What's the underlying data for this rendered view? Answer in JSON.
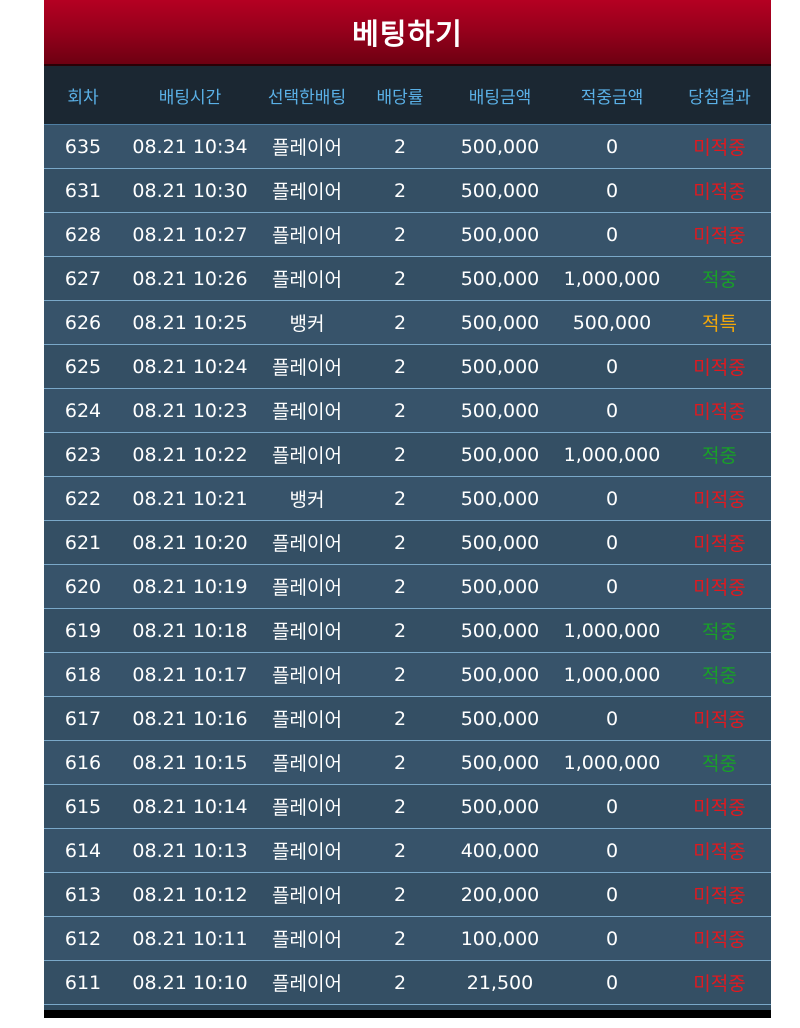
{
  "title": "베팅하기",
  "columns": {
    "round": "회차",
    "time": "배팅시간",
    "pick": "선택한배팅",
    "odds": "배당률",
    "bet": "배팅금액",
    "win": "적중금액",
    "result": "당첨결과"
  },
  "colors": {
    "lose": "#e0191f",
    "win": "#18a028",
    "tie": "#f2a70a",
    "header_text": "#5ab0e6"
  },
  "rows": [
    {
      "round": "635",
      "time": "08.21 10:34",
      "pick": "플레이어",
      "odds": "2",
      "bet": "500,000",
      "win": "0",
      "result": "미적중",
      "status": "lose"
    },
    {
      "round": "631",
      "time": "08.21 10:30",
      "pick": "플레이어",
      "odds": "2",
      "bet": "500,000",
      "win": "0",
      "result": "미적중",
      "status": "lose"
    },
    {
      "round": "628",
      "time": "08.21 10:27",
      "pick": "플레이어",
      "odds": "2",
      "bet": "500,000",
      "win": "0",
      "result": "미적중",
      "status": "lose"
    },
    {
      "round": "627",
      "time": "08.21 10:26",
      "pick": "플레이어",
      "odds": "2",
      "bet": "500,000",
      "win": "1,000,000",
      "result": "적중",
      "status": "win"
    },
    {
      "round": "626",
      "time": "08.21 10:25",
      "pick": "뱅커",
      "odds": "2",
      "bet": "500,000",
      "win": "500,000",
      "result": "적특",
      "status": "tie"
    },
    {
      "round": "625",
      "time": "08.21 10:24",
      "pick": "플레이어",
      "odds": "2",
      "bet": "500,000",
      "win": "0",
      "result": "미적중",
      "status": "lose"
    },
    {
      "round": "624",
      "time": "08.21 10:23",
      "pick": "플레이어",
      "odds": "2",
      "bet": "500,000",
      "win": "0",
      "result": "미적중",
      "status": "lose"
    },
    {
      "round": "623",
      "time": "08.21 10:22",
      "pick": "플레이어",
      "odds": "2",
      "bet": "500,000",
      "win": "1,000,000",
      "result": "적중",
      "status": "win"
    },
    {
      "round": "622",
      "time": "08.21 10:21",
      "pick": "뱅커",
      "odds": "2",
      "bet": "500,000",
      "win": "0",
      "result": "미적중",
      "status": "lose"
    },
    {
      "round": "621",
      "time": "08.21 10:20",
      "pick": "플레이어",
      "odds": "2",
      "bet": "500,000",
      "win": "0",
      "result": "미적중",
      "status": "lose"
    },
    {
      "round": "620",
      "time": "08.21 10:19",
      "pick": "플레이어",
      "odds": "2",
      "bet": "500,000",
      "win": "0",
      "result": "미적중",
      "status": "lose"
    },
    {
      "round": "619",
      "time": "08.21 10:18",
      "pick": "플레이어",
      "odds": "2",
      "bet": "500,000",
      "win": "1,000,000",
      "result": "적중",
      "status": "win"
    },
    {
      "round": "618",
      "time": "08.21 10:17",
      "pick": "플레이어",
      "odds": "2",
      "bet": "500,000",
      "win": "1,000,000",
      "result": "적중",
      "status": "win"
    },
    {
      "round": "617",
      "time": "08.21 10:16",
      "pick": "플레이어",
      "odds": "2",
      "bet": "500,000",
      "win": "0",
      "result": "미적중",
      "status": "lose"
    },
    {
      "round": "616",
      "time": "08.21 10:15",
      "pick": "플레이어",
      "odds": "2",
      "bet": "500,000",
      "win": "1,000,000",
      "result": "적중",
      "status": "win"
    },
    {
      "round": "615",
      "time": "08.21 10:14",
      "pick": "플레이어",
      "odds": "2",
      "bet": "500,000",
      "win": "0",
      "result": "미적중",
      "status": "lose"
    },
    {
      "round": "614",
      "time": "08.21 10:13",
      "pick": "플레이어",
      "odds": "2",
      "bet": "400,000",
      "win": "0",
      "result": "미적중",
      "status": "lose"
    },
    {
      "round": "613",
      "time": "08.21 10:12",
      "pick": "플레이어",
      "odds": "2",
      "bet": "200,000",
      "win": "0",
      "result": "미적중",
      "status": "lose"
    },
    {
      "round": "612",
      "time": "08.21 10:11",
      "pick": "플레이어",
      "odds": "2",
      "bet": "100,000",
      "win": "0",
      "result": "미적중",
      "status": "lose"
    },
    {
      "round": "611",
      "time": "08.21 10:10",
      "pick": "플레이어",
      "odds": "2",
      "bet": "21,500",
      "win": "0",
      "result": "미적중",
      "status": "lose"
    }
  ]
}
